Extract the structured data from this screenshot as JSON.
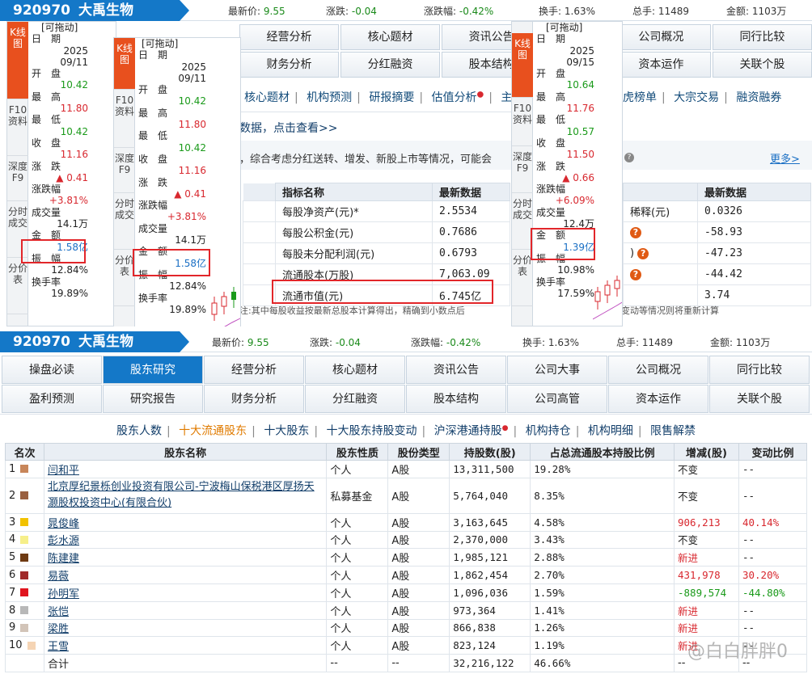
{
  "stock": {
    "code": "920970",
    "name": "大禹生物",
    "price_label": "最新价:",
    "price": "9.55",
    "chg_label": "涨跌:",
    "chg": "-0.04",
    "pct_label": "涨跌幅:",
    "pct": "-0.42%",
    "turn_label": "换手:",
    "turn": "1.63%",
    "hands_label": "总手:",
    "hands": "11489",
    "amt_label": "金额:",
    "amt": "1103万"
  },
  "top_nav": {
    "row1": [
      "经营分析",
      "核心题材",
      "资讯公告",
      "公司概况",
      "同行比较"
    ],
    "row2": [
      "财务分析",
      "分红融资",
      "股本结构",
      "资本运作",
      "关联个股"
    ]
  },
  "top_tabs": [
    "核心题材",
    "机构预测",
    "研报摘要",
    "估值分析",
    "主要",
    "虎榜单",
    "大宗交易",
    "融资融券"
  ],
  "top_notice": {
    "link": "数据，点击查看>>",
    "desc": "，综合考虑分红送转、增发、新股上市等情况，可能会",
    "more": "更多>"
  },
  "indicators": {
    "h_name": "指标名称",
    "h_val": "最新数据",
    "rows": [
      {
        "name": "每股净资产(元)*",
        "val": "2.5534"
      },
      {
        "name": "每股公积金(元)",
        "val": "0.7686"
      },
      {
        "name": "每股未分配利润(元)",
        "val": "0.6793"
      },
      {
        "name": "流通股本(万股)",
        "val": "7,063.09"
      },
      {
        "name": "流通市值(元)",
        "val": "6.745亿"
      }
    ],
    "foot": "注:其中每股收益按最新总股本计算得出，精确到小数点后"
  },
  "indicators2": {
    "h_val": "最新数据",
    "rows": [
      {
        "name": "稀释(元)",
        "val": "0.0326"
      },
      {
        "name": "",
        "val": "-58.93"
      },
      {
        "name": ")",
        "val": "-47.23"
      },
      {
        "name": "",
        "val": "-44.42"
      },
      {
        "name": "",
        "val": "3.74"
      }
    ],
    "foot": "变动等情况则将重新计算"
  },
  "kpanel": {
    "drag": "[可拖动]",
    "side": [
      "K线图",
      "F10资料",
      "深度F9",
      "分时成交",
      "分价表"
    ],
    "labels": {
      "date": "日　期",
      "open": "开　盘",
      "high": "最　高",
      "low": "最　低",
      "close": "收　盘",
      "chg": "涨　跌",
      "pct": "涨跌幅",
      "vol": "成交量",
      "amt": "金　额",
      "amp": "振　幅",
      "turn": "换手率"
    },
    "p1": {
      "date": "2025\n09/11",
      "open": "10.42",
      "high": "11.80",
      "low": "10.42",
      "close": "11.16",
      "chg": "▲ 0.41",
      "pct": "+3.81%",
      "vol": "14.1万",
      "amt": "1.58亿",
      "amp": "12.84%",
      "turn": "19.89%"
    },
    "p3": {
      "date": "2025\n09/15",
      "open": "10.64",
      "high": "11.76",
      "low": "10.57",
      "close": "11.50",
      "chg": "▲ 0.66",
      "pct": "+6.09%",
      "vol": "12.4万",
      "amt": "1.39亿",
      "amp": "10.98%",
      "turn": "17.59%"
    }
  },
  "bottom_nav": {
    "row1": [
      "操盘必读",
      "股东研究",
      "经营分析",
      "核心题材",
      "资讯公告",
      "公司大事",
      "公司概况",
      "同行比较"
    ],
    "row2": [
      "盈利预测",
      "研究报告",
      "财务分析",
      "分红融资",
      "股本结构",
      "公司高管",
      "资本运作",
      "关联个股"
    ],
    "active": "股东研究"
  },
  "sub_tabs": [
    {
      "label": "股东人数",
      "active": false
    },
    {
      "label": "十大流通股东",
      "active": true
    },
    {
      "label": "十大股东",
      "active": false
    },
    {
      "label": "十大股东持股变动",
      "active": false
    },
    {
      "label": "沪深港通持股",
      "active": false,
      "dot": true
    },
    {
      "label": "机构持仓",
      "active": false
    },
    {
      "label": "机构明细",
      "active": false
    },
    {
      "label": "限售解禁",
      "active": false
    }
  ],
  "holders": {
    "headers": [
      "名次",
      "股东名称",
      "股东性质",
      "股份类型",
      "持股数(股)",
      "占总流通股本持股比例",
      "增减(股)",
      "变动比例"
    ],
    "rows": [
      {
        "rank": "1",
        "color": "#c8865a",
        "name": "闫和平",
        "type": "个人",
        "share": "A股",
        "num": "13,311,500",
        "pct": "19.28%",
        "chg": "不变",
        "ratio": "--"
      },
      {
        "rank": "2",
        "color": "#9a6040",
        "name": "北京厚纪景栎创业投资有限公司-宁波梅山保税港区厚扬天灏股权投资中心(有限合伙)",
        "type": "私募基金",
        "share": "A股",
        "num": "5,764,040",
        "pct": "8.35%",
        "chg": "不变",
        "ratio": "--"
      },
      {
        "rank": "3",
        "color": "#f2c200",
        "name": "晁俊峰",
        "type": "个人",
        "share": "A股",
        "num": "3,163,645",
        "pct": "4.58%",
        "chg": "906,213",
        "ratio": "40.14%"
      },
      {
        "rank": "4",
        "color": "#f6ef8a",
        "name": "彭水源",
        "type": "个人",
        "share": "A股",
        "num": "2,370,000",
        "pct": "3.43%",
        "chg": "不变",
        "ratio": "--"
      },
      {
        "rank": "5",
        "color": "#6e3a12",
        "name": "陈建建",
        "type": "个人",
        "share": "A股",
        "num": "1,985,121",
        "pct": "2.88%",
        "chg": "新进",
        "ratio": "--"
      },
      {
        "rank": "6",
        "color": "#a02a2a",
        "name": "易薇",
        "type": "个人",
        "share": "A股",
        "num": "1,862,454",
        "pct": "2.70%",
        "chg": "431,978",
        "ratio": "30.20%"
      },
      {
        "rank": "7",
        "color": "#e0141e",
        "name": "孙明军",
        "type": "个人",
        "share": "A股",
        "num": "1,096,036",
        "pct": "1.59%",
        "chg": "-889,574",
        "ratio": "-44.80%"
      },
      {
        "rank": "8",
        "color": "#b8b8b8",
        "name": "张恺",
        "type": "个人",
        "share": "A股",
        "num": "973,364",
        "pct": "1.41%",
        "chg": "新进",
        "ratio": "--"
      },
      {
        "rank": "9",
        "color": "#d2c4b8",
        "name": "梁胜",
        "type": "个人",
        "share": "A股",
        "num": "866,838",
        "pct": "1.26%",
        "chg": "新进",
        "ratio": "--"
      },
      {
        "rank": "10",
        "color": "#f5d4b4",
        "name": "王雪",
        "type": "个人",
        "share": "A股",
        "num": "823,124",
        "pct": "1.19%",
        "chg": "新进",
        "ratio": "--"
      }
    ],
    "total": {
      "label": "合计",
      "type": "--",
      "share": "--",
      "num": "32,216,122",
      "pct": "46.66%",
      "chg": "--",
      "ratio": "--"
    }
  },
  "watermark": "@白白胖胖0"
}
